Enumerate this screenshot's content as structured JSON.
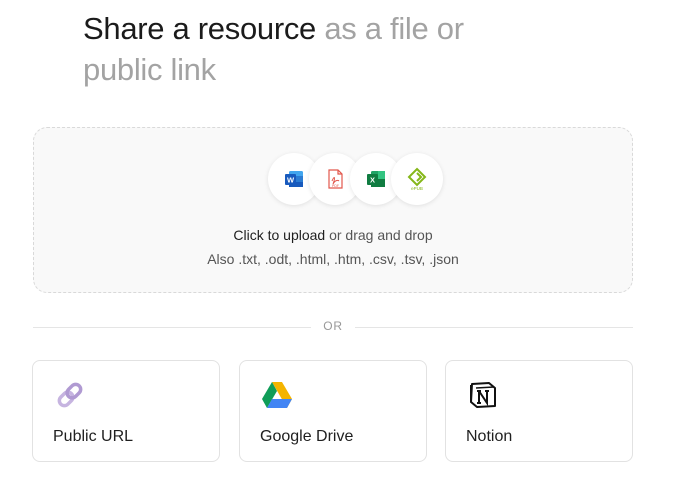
{
  "heading": {
    "primary": "Share a resource",
    "secondary": "as a file or public link"
  },
  "upload": {
    "file_type_icons": [
      "word-icon",
      "pdf-icon",
      "excel-icon",
      "epub-icon"
    ],
    "click_label": "Click to upload",
    "drag_label": "or drag and drop",
    "also_label": "Also .txt, .odt, .html, .htm, .csv, .tsv, .json"
  },
  "divider": {
    "label": "OR"
  },
  "sources": [
    {
      "label": "Public URL",
      "icon": "link-icon"
    },
    {
      "label": "Google Drive",
      "icon": "google-drive-icon"
    },
    {
      "label": "Notion",
      "icon": "notion-icon"
    }
  ],
  "colors": {
    "word": "#185abd",
    "pdf": "#e2574c",
    "excel": "#107c41",
    "epub": "#85b719",
    "link": "#c6b4e0",
    "drive_green": "#0f9d58",
    "drive_yellow": "#f4b400",
    "drive_blue": "#4285f4"
  }
}
